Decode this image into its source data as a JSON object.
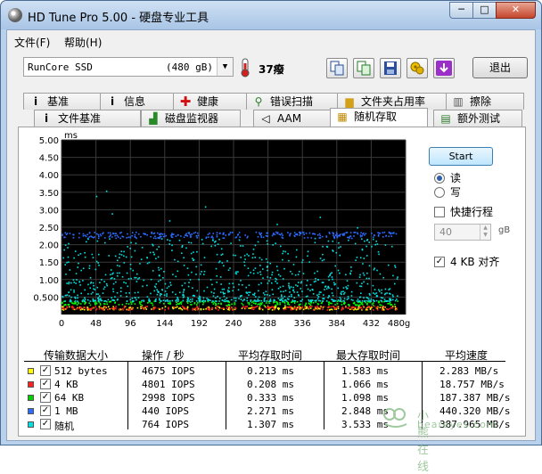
{
  "window": {
    "title": "HD Tune Pro 5.00 - 硬盘专业工具",
    "minimize": "─",
    "maximize": "□",
    "close": "✕"
  },
  "menu": {
    "file": "文件(F)",
    "help": "帮助(H)"
  },
  "toolbar": {
    "drive_name": "RunCore SSD",
    "drive_size": "(480 gB)",
    "temperature": "37癈",
    "exit_label": "退出",
    "icons": [
      "copy-icon",
      "copy-all-icon",
      "save-icon",
      "options-icon",
      "download-icon"
    ]
  },
  "tabs": {
    "row1": [
      {
        "label": "基准",
        "icon": "info-icon"
      },
      {
        "label": "信息",
        "icon": "info-icon"
      },
      {
        "label": "健康",
        "icon": "health-icon"
      },
      {
        "label": "错误扫描",
        "icon": "magnifier-icon"
      },
      {
        "label": "文件夹占用率",
        "icon": "folder-icon"
      },
      {
        "label": "擦除",
        "icon": "trash-icon"
      }
    ],
    "row2": [
      {
        "label": "文件基准",
        "icon": "info-icon"
      },
      {
        "label": "磁盘监视器",
        "icon": "monitor-icon"
      },
      {
        "label": "AAM",
        "icon": "speaker-icon"
      },
      {
        "label": "随机存取",
        "icon": "random-icon"
      },
      {
        "label": "额外测试",
        "icon": "extra-icon"
      }
    ]
  },
  "controls": {
    "start_label": "Start",
    "read_label": "读",
    "write_label": "写",
    "read_selected": true,
    "quick_label": "快捷行程",
    "quick_checked": false,
    "quick_value": "40",
    "quick_unit": "gB",
    "align_label": "4 KB 对齐",
    "align_checked": true
  },
  "chart_data": {
    "type": "scatter",
    "ylabel": "ms",
    "xlabel": "",
    "ylim": [
      0,
      5
    ],
    "xlim": [
      0,
      480
    ],
    "y_ticks": [
      "5.00",
      "4.50",
      "4.00",
      "3.50",
      "3.00",
      "2.50",
      "2.00",
      "1.50",
      "1.00",
      "0.500"
    ],
    "x_ticks": [
      "0",
      "48",
      "96",
      "144",
      "192",
      "240",
      "288",
      "336",
      "384",
      "432",
      "480gB"
    ],
    "grid": true,
    "series": [
      {
        "name": "512 bytes",
        "color": "#ffff00",
        "band_min": 0.15,
        "band_max": 0.25
      },
      {
        "name": "4 KB",
        "color": "#ff2020",
        "band_min": 0.15,
        "band_max": 0.26
      },
      {
        "name": "64 KB",
        "color": "#00ff00",
        "band_min": 0.28,
        "band_max": 0.4
      },
      {
        "name": "1 MB",
        "color": "#2d6bff",
        "band_min": 2.2,
        "band_max": 2.38
      },
      {
        "name": "随机",
        "color": "#00e0e0",
        "band_min": 0.4,
        "band_max": 2.2
      }
    ]
  },
  "results": {
    "headers": [
      "传输数据大小",
      "操作 / 秒",
      "平均存取时间",
      "最大存取时间",
      "平均速度"
    ],
    "rows": [
      {
        "size": "512 bytes",
        "color": "#ffff00",
        "ops": "4675 IOPS",
        "avg": "0.213 ms",
        "max": "1.583 ms",
        "speed": "2.283 MB/s"
      },
      {
        "size": "4 KB",
        "color": "#ff2020",
        "ops": "4801 IOPS",
        "avg": "0.208 ms",
        "max": "1.066 ms",
        "speed": "18.757 MB/s"
      },
      {
        "size": "64 KB",
        "color": "#00d000",
        "ops": "2998 IOPS",
        "avg": "0.333 ms",
        "max": "1.098 ms",
        "speed": "187.387 MB/s"
      },
      {
        "size": "1 MB",
        "color": "#2d6bff",
        "ops": "440 IOPS",
        "avg": "2.271 ms",
        "max": "2.848 ms",
        "speed": "440.320 MB/s"
      },
      {
        "size": "随机",
        "color": "#00e0e0",
        "ops": "764 IOPS",
        "avg": "1.307 ms",
        "max": "3.533 ms",
        "speed": "387.965 MB/s"
      }
    ]
  },
  "watermark": {
    "text": "小熊在线",
    "sub": "beareyes.com"
  }
}
